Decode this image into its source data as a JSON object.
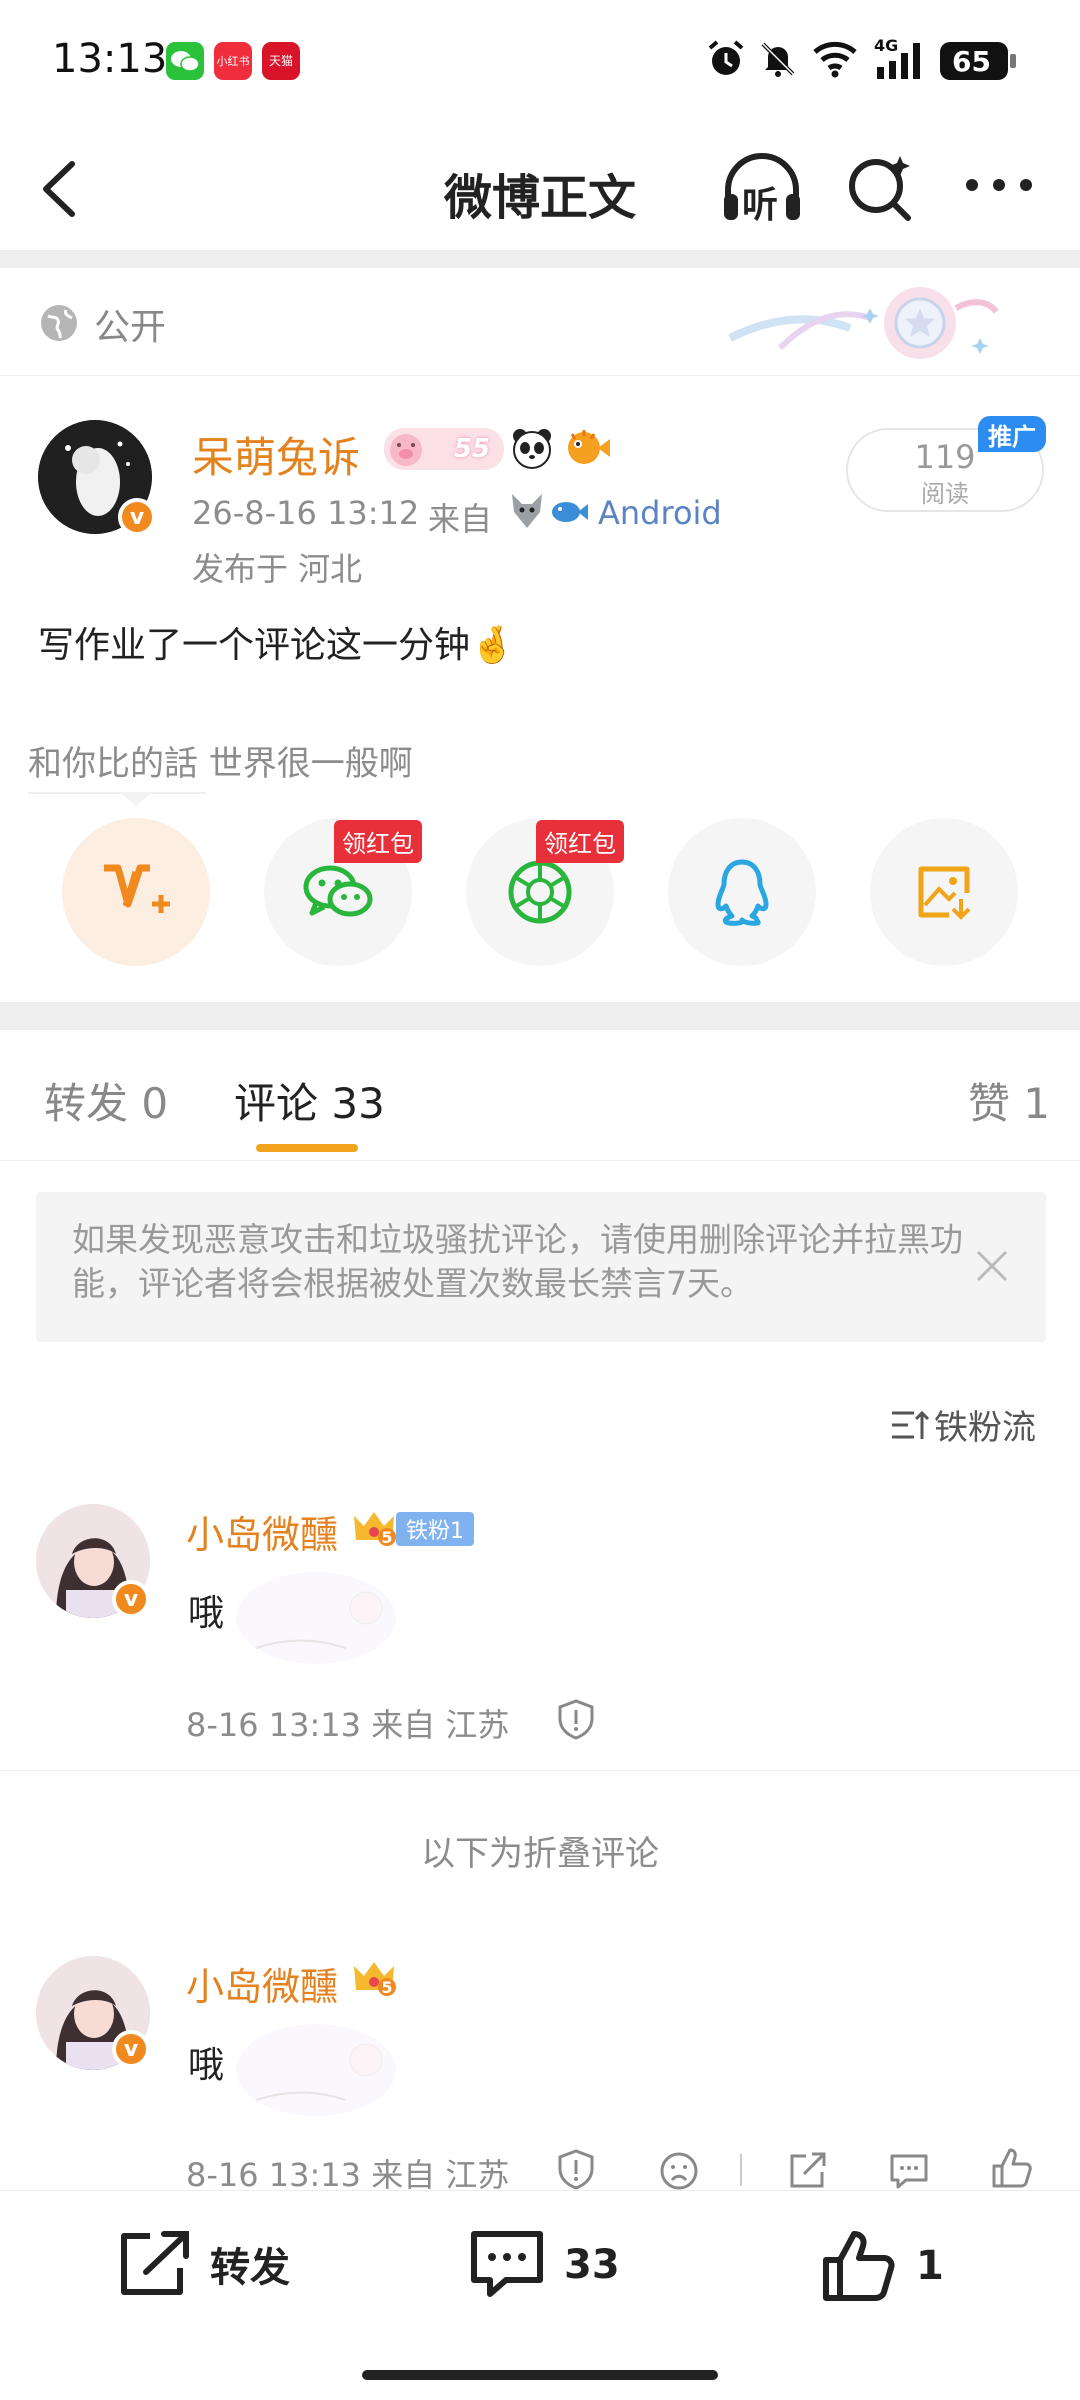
{
  "status_bar": {
    "time": "13:13",
    "apps": [
      "wechat-icon",
      "xiaohongshu-icon",
      "tmall-icon"
    ],
    "app_labels": {
      "xiaohongshu": "小红书",
      "tmall": "天猫"
    },
    "network": "4G",
    "battery": "65"
  },
  "nav": {
    "title": "微博正文",
    "listen_label": "听"
  },
  "post": {
    "visibility": "公开",
    "author": "呆萌兔诉",
    "author_level": "55",
    "date": "26-8-16 13:12",
    "source_prefix": "来自",
    "source": "Android",
    "location": "发布于 河北",
    "read_count": "119",
    "read_label": "阅读",
    "promo_badge": "推广",
    "text": "写作业了一个评论这一分钟🤞",
    "signature": "和你比的話 世界很一般啊"
  },
  "share": {
    "red_packet_label": "领红包",
    "items": [
      {
        "icon": "weibo-v-plus-icon",
        "color": "#f08a1f"
      },
      {
        "icon": "wechat-icon",
        "color": "#2ab53d",
        "red_packet": true
      },
      {
        "icon": "moments-icon",
        "color": "#2ab53d",
        "red_packet": true
      },
      {
        "icon": "qq-icon",
        "color": "#2aa7e0"
      },
      {
        "icon": "save-image-icon",
        "color": "#f0a418"
      }
    ]
  },
  "tabs": {
    "repost": "转发 0",
    "comment": "评论 33",
    "like": "赞 1",
    "active": "comment",
    "accent": "#f2a51c"
  },
  "notice": {
    "text": "如果发现恶意攻击和垃圾骚扰评论，请使用删除评论并拉黑功能，评论者将会根据被处置次数最长禁言7天。"
  },
  "sort": {
    "label": "铁粉流"
  },
  "comments": [
    {
      "user": "小岛微醺",
      "badge": "铁粉1",
      "crown_level": "5",
      "text": "哦",
      "meta": "8-16 13:13 来自 江苏"
    }
  ],
  "folded": {
    "divider": "以下为折叠评论",
    "comments": [
      {
        "user": "小岛微醺",
        "crown_level": "5",
        "text": "哦",
        "meta": "8-16 13:13 来自 江苏"
      }
    ]
  },
  "bottom_bar": {
    "repost_label": "转发",
    "comment_count": "33",
    "like_count": "1"
  }
}
